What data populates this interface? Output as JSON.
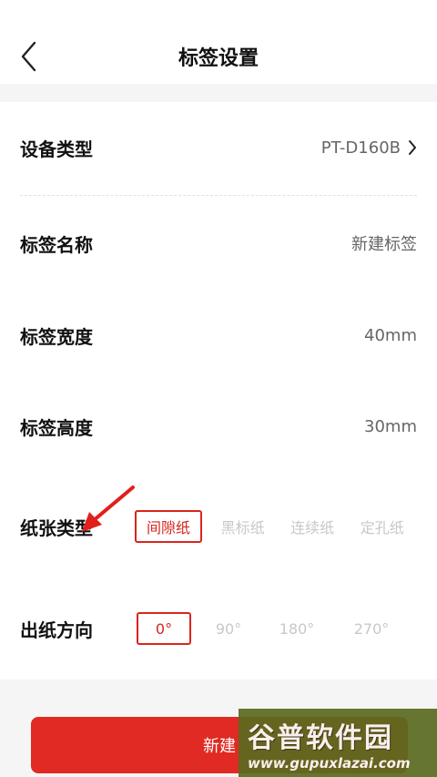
{
  "header": {
    "title": "标签设置"
  },
  "settings": {
    "device_type": {
      "label": "设备类型",
      "value": "PT-D160B"
    },
    "label_name": {
      "label": "标签名称",
      "value": "新建标签"
    },
    "label_width": {
      "label": "标签宽度",
      "value": "40mm"
    },
    "label_height": {
      "label": "标签高度",
      "value": "30mm"
    }
  },
  "paper_type": {
    "label": "纸张类型",
    "options": [
      "间隙纸",
      "黑标纸",
      "连续纸",
      "定孔纸"
    ],
    "selected": "间隙纸"
  },
  "print_direction": {
    "label": "出纸方向",
    "options": [
      "0°",
      "90°",
      "180°",
      "270°"
    ],
    "selected": "0°"
  },
  "footer": {
    "button_label": "新建"
  },
  "watermark": {
    "title": "谷普软件园",
    "url": "www.gupuxlazai.com"
  },
  "colors": {
    "accent": "#e02a23",
    "annotation_arrow": "#e0201a"
  },
  "icons": {
    "back": "chevron-left-icon",
    "disclosure": "chevron-right-icon",
    "annotation": "arrow-annotation-icon"
  }
}
